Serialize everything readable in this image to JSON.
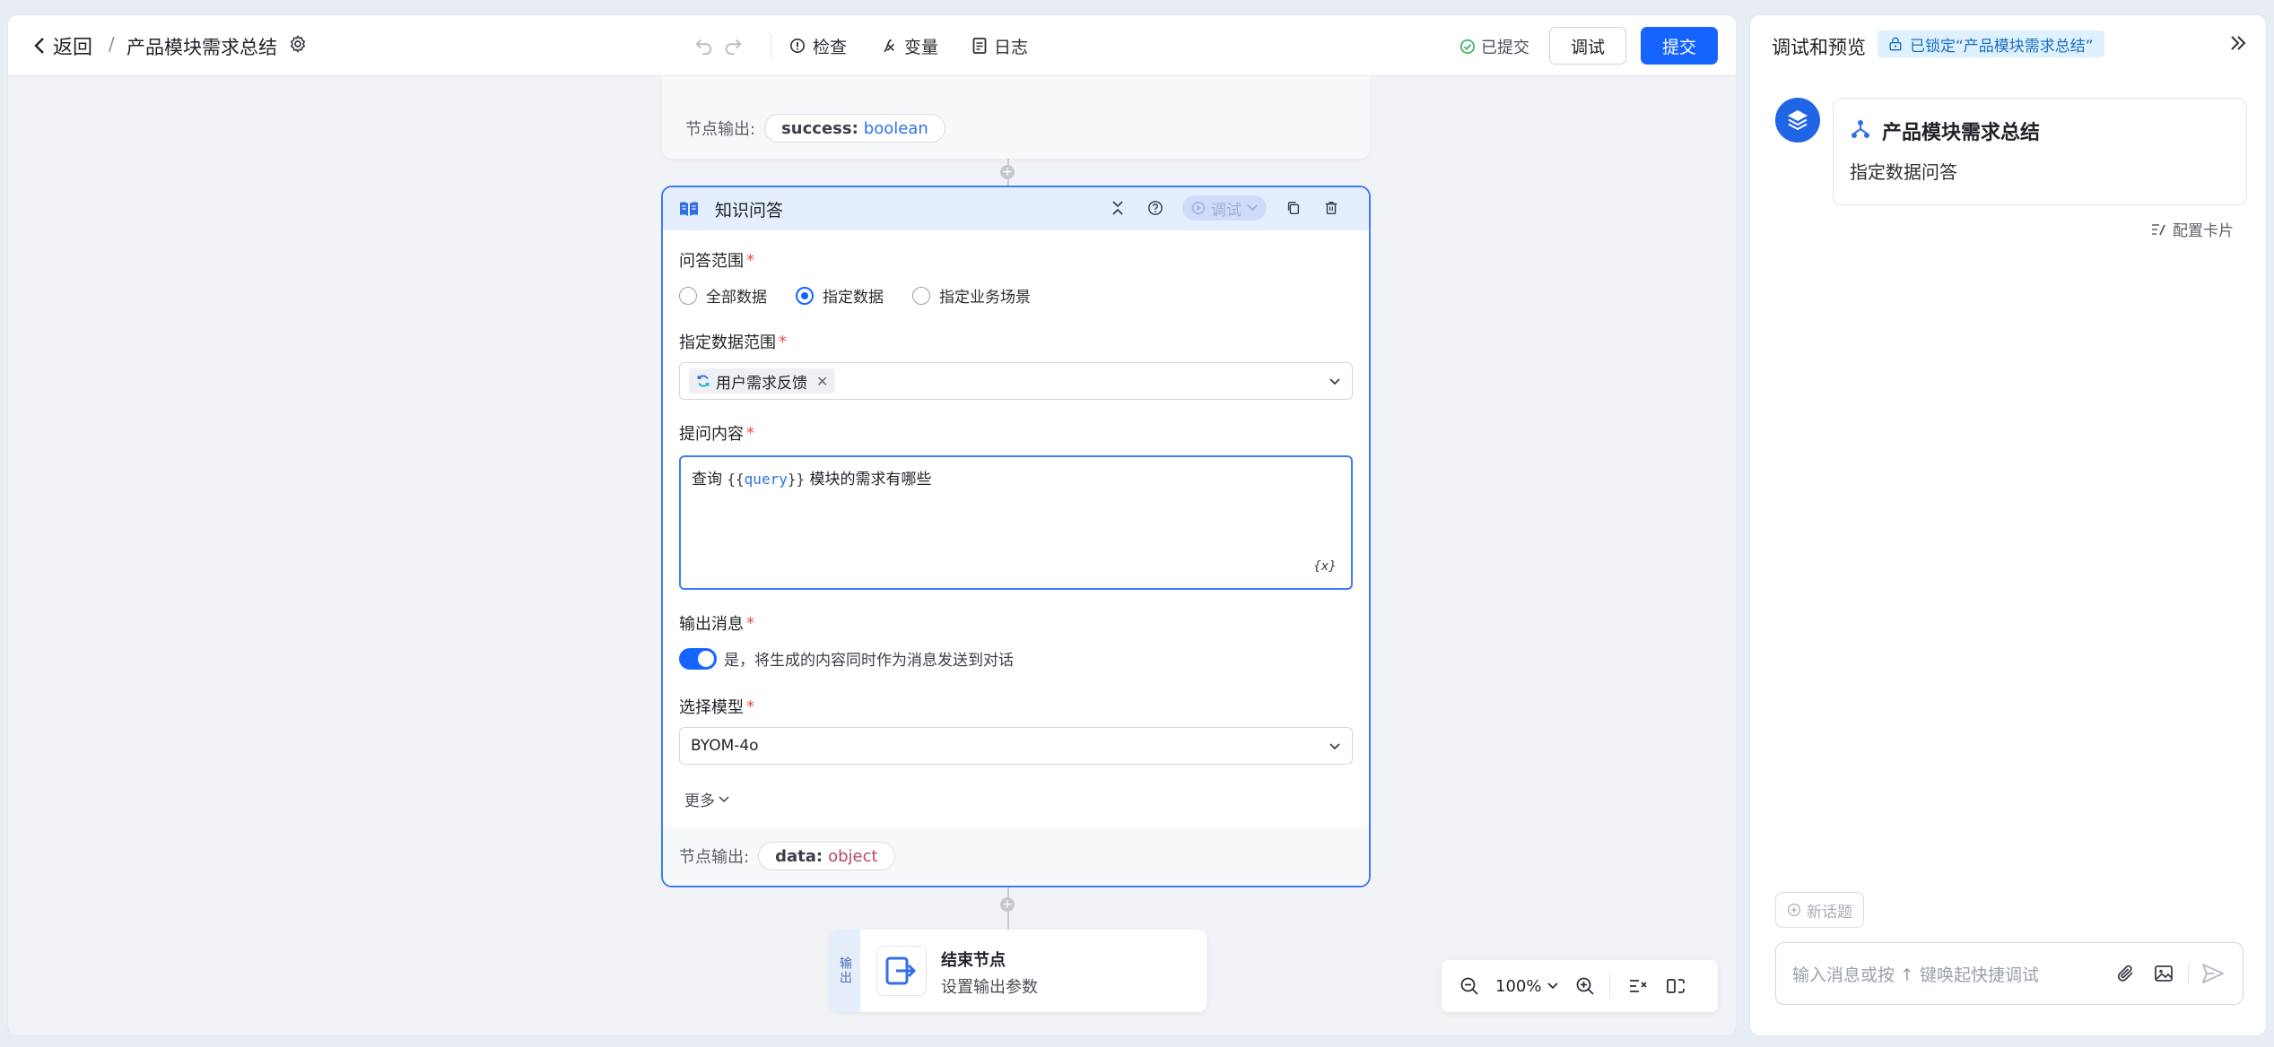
{
  "header": {
    "back_label": "返回",
    "breadcrumb_sep": "/",
    "title": "产品模块需求总结",
    "tools": {
      "check": "检查",
      "variables": "变量",
      "logs": "日志"
    },
    "status": "已提交",
    "debug_label": "调试",
    "submit_label": "提交"
  },
  "prev_node": {
    "output_label": "节点输出:",
    "output_name": "success:",
    "output_type": "boolean"
  },
  "node": {
    "title": "知识问答",
    "test_label": "调试",
    "scope": {
      "label": "问答范围",
      "options": [
        "全部数据",
        "指定数据",
        "指定业务场景"
      ],
      "selected": "指定数据"
    },
    "data_range": {
      "label": "指定数据范围",
      "tag": "用户需求反馈"
    },
    "question": {
      "label": "提问内容",
      "prefix": "查询 ",
      "open": "{{",
      "variable": "query",
      "close": "}}",
      "suffix": " 模块的需求有哪些",
      "fx_label": "{x}"
    },
    "output_message": {
      "label": "输出消息",
      "toggle_on": true,
      "desc": "是，将生成的内容同时作为消息发送到对话"
    },
    "model": {
      "label": "选择模型",
      "value": "BYOM-4o"
    },
    "more_label": "更多",
    "output_label": "节点输出:",
    "output_name": "data:",
    "output_type": "object"
  },
  "end_node": {
    "side_label": "输出",
    "title": "结束节点",
    "subtitle": "设置输出参数"
  },
  "zoom": {
    "level": "100%"
  },
  "panel": {
    "title": "调试和预览",
    "locked_label": "已锁定“产品模块需求总结”",
    "card_title": "产品模块需求总结",
    "card_subtitle": "指定数据问答",
    "config_card": "配置卡片",
    "new_topic": "新话题",
    "input_placeholder": "输入消息或按 ↑ 键唤起快捷调试"
  },
  "colors": {
    "primary": "#1664ff",
    "node_border": "#3d7bf7",
    "node_header_bg": "#e4eefe",
    "required": "#f04b4b",
    "type_boolean": "#2f6fe8",
    "type_object": "#b5476f"
  }
}
